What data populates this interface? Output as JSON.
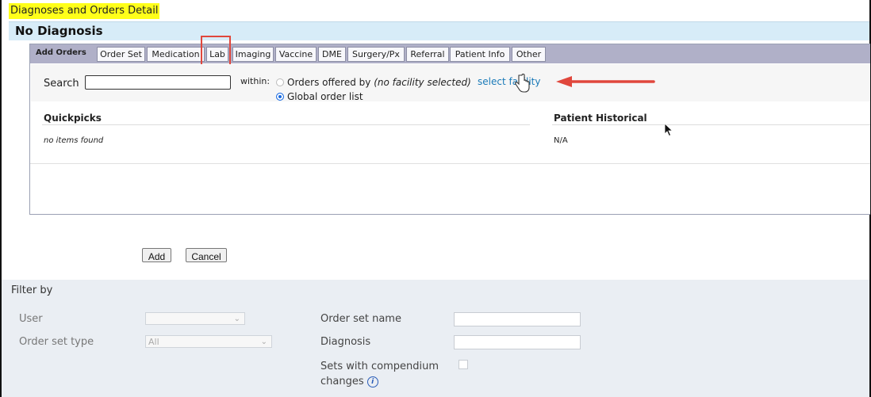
{
  "header": {
    "title": "Diagnoses and Orders Detail",
    "diagnosis_title": "No Diagnosis"
  },
  "orders": {
    "section_label": "Add Orders",
    "tabs": [
      {
        "label": "Order Set"
      },
      {
        "label": "Medication"
      },
      {
        "label": "Lab",
        "highlighted": true
      },
      {
        "label": "Imaging"
      },
      {
        "label": "Vaccine"
      },
      {
        "label": "DME"
      },
      {
        "label": "Surgery/Px"
      },
      {
        "label": "Referral"
      },
      {
        "label": "Patient Info"
      },
      {
        "label": "Other"
      }
    ],
    "search": {
      "label": "Search",
      "value": "",
      "within_label": "within:",
      "option_offered_label": "Orders offered by",
      "option_offered_note": "(no facility selected)",
      "option_offered_selected": false,
      "option_global_label": "Global order list",
      "option_global_selected": true,
      "select_facility_link": "select facility"
    },
    "quickpicks": {
      "title": "Quickpicks",
      "empty_text": "no items found"
    },
    "patient_historical": {
      "title": "Patient Historical",
      "value": "N/A"
    }
  },
  "actions": {
    "add_label": "Add",
    "cancel_label": "Cancel"
  },
  "filter": {
    "title": "Filter by",
    "user_label": "User",
    "user_value": "",
    "order_set_type_label": "Order set type",
    "order_set_type_value": "All",
    "order_set_name_label": "Order set name",
    "diagnosis_label": "Diagnosis",
    "compendium_label_line1": "Sets with compendium",
    "compendium_label_line2": "changes",
    "compendium_checked": false
  },
  "colors": {
    "title_highlight": "#ffff1a",
    "diagnosis_bar": "#d7ecf8",
    "tabs_bar": "#b0b0c8",
    "link": "#1a7ab8",
    "annotation_red": "#e0473c",
    "filter_bg": "#eaeef3"
  },
  "icons": {
    "hand_cursor": "hand-pointer-icon",
    "mouse_pointer": "mouse-pointer-icon",
    "annotation_arrow": "red-arrow-icon",
    "info": "info-icon",
    "dropdown": "chevron-down-icon"
  }
}
